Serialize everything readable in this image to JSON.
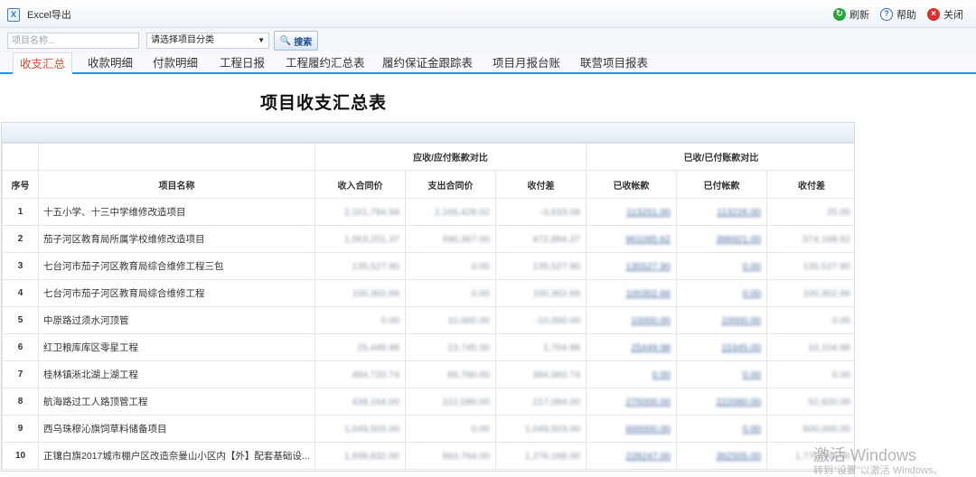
{
  "toolbar": {
    "export_label": "Excel导出",
    "refresh_label": "刷新",
    "help_label": "帮助",
    "close_label": "关闭"
  },
  "search": {
    "name_placeholder": "项目名称...",
    "category_value": "请选择项目分类",
    "search_label": "搜索"
  },
  "tabs": [
    {
      "label": "收支汇总"
    },
    {
      "label": "收款明细"
    },
    {
      "label": "付款明细"
    },
    {
      "label": "工程日报"
    },
    {
      "label": "工程履约汇总表"
    },
    {
      "label": "履约保证金跟踪表"
    },
    {
      "label": "项目月报台账"
    },
    {
      "label": "联营项目报表"
    }
  ],
  "report": {
    "title": "项目收支汇总表",
    "group_headers": [
      "应收/应付账款对比",
      "已收/已付账款对比"
    ],
    "columns": [
      "序号",
      "项目名称",
      "收入合同价",
      "支出合同价",
      "收付差",
      "已收帐款",
      "已付帐款",
      "收付差"
    ],
    "rows": [
      {
        "no": "1",
        "name": "十五小学、十三中学维修改造项目",
        "v1": "2,161,794.94",
        "v2": "2,165,428.02",
        "v3": "-3,633.08",
        "v4": "113251.00",
        "v5": "113226.00",
        "v6": "25.00"
      },
      {
        "no": "2",
        "name": "茄子河区教育局所属学校维修改造项目",
        "v1": "1,063,251.37",
        "v2": "590,367.00",
        "v3": "472,884.37",
        "v4": "961085.62",
        "v5": "386921.00",
        "v6": "574,168.62"
      },
      {
        "no": "3",
        "name": "七台河市茄子河区教育局综合维修工程三包",
        "v1": "135,527.90",
        "v2": "0.00",
        "v3": "135,527.90",
        "v4": "135527.90",
        "v5": "0.00",
        "v6": "135,527.90"
      },
      {
        "no": "4",
        "name": "七台河市茄子河区教育局综合维修工程",
        "v1": "100,302.66",
        "v2": "0.00",
        "v3": "100,302.66",
        "v4": "100302.66",
        "v5": "0.00",
        "v6": "100,302.66"
      },
      {
        "no": "5",
        "name": "中原路过须水河顶管",
        "v1": "0.00",
        "v2": "10,000.00",
        "v3": "-10,000.00",
        "v4": "10000.00",
        "v5": "10000.00",
        "v6": "0.00"
      },
      {
        "no": "6",
        "name": "红卫粮库库区零星工程",
        "v1": "25,449.98",
        "v2": "23,745.00",
        "v3": "1,704.98",
        "v4": "25449.98",
        "v5": "15345.00",
        "v6": "10,104.98"
      },
      {
        "no": "7",
        "name": "桂林镇淅北湖上湖工程",
        "v1": "484,720.74",
        "v2": "89,760.00",
        "v3": "394,960.74",
        "v4": "0.00",
        "v5": "0.00",
        "v6": "0.00"
      },
      {
        "no": "8",
        "name": "航海路过工人路顶管工程",
        "v1": "439,164.00",
        "v2": "222,080.00",
        "v3": "217,084.00",
        "v4": "275000.00",
        "v5": "222080.00",
        "v6": "52,920.00"
      },
      {
        "no": "9",
        "name": "西乌珠穆沁旗饲草料储备项目",
        "v1": "1,049,503.00",
        "v2": "0.00",
        "v3": "1,049,503.00",
        "v4": "600000.00",
        "v5": "0.00",
        "v6": "600,000.00"
      },
      {
        "no": "10",
        "name": "正镶白旗2017城市棚户区改造奈曼山小区内【外】配套基础设...",
        "v1": "1,939,832.00",
        "v2": "663,764.00",
        "v3": "1,276,168.00",
        "v4": "228247.00",
        "v5": "362505.00",
        "v6": "1,776,068.00"
      }
    ]
  },
  "watermark": {
    "line1": "激活 Windows",
    "line2": "转到\"设置\"以激活 Windows。"
  },
  "colors": {
    "active_tab": "#e24a2d",
    "tab_underline": "#2f8ee0",
    "refresh_icon": "#2aa33a",
    "help_icon": "#3a6fc4",
    "close_icon": "#d9302c"
  }
}
